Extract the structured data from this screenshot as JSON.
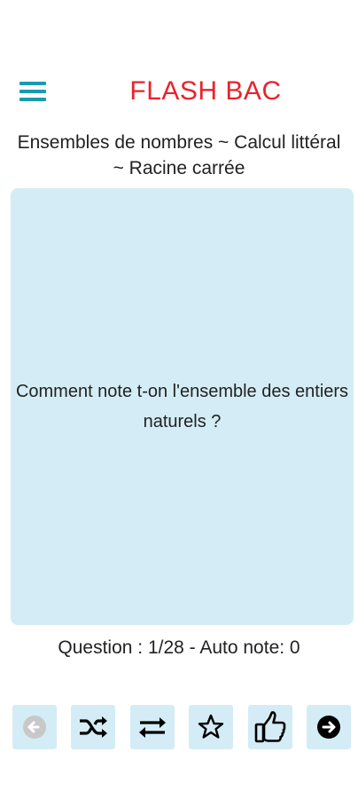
{
  "header": {
    "title": "FLASH BAC",
    "menu_icon": "hamburger-menu-icon"
  },
  "subtitle": "Ensembles de nombres ~ Calcul littéral ~ Racine carrée",
  "card": {
    "question": "Comment note t-on l'ensemble des entiers naturels ?"
  },
  "status": {
    "text": "Question : 1/28 - Auto note: 0",
    "current": 1,
    "total": 28,
    "auto_note": 0
  },
  "toolbar": {
    "buttons": [
      {
        "icon": "back-arrow-icon",
        "enabled": false
      },
      {
        "icon": "shuffle-icon",
        "enabled": true
      },
      {
        "icon": "swap-icon",
        "enabled": true
      },
      {
        "icon": "star-icon",
        "enabled": true
      },
      {
        "icon": "thumbs-up-icon",
        "enabled": true
      },
      {
        "icon": "next-arrow-icon",
        "enabled": true
      }
    ]
  },
  "colors": {
    "accent": "#1a9bb0",
    "title_red": "#e8232c",
    "card_bg": "#d4ecf5",
    "text": "#222222",
    "disabled": "#c8c8c8"
  }
}
